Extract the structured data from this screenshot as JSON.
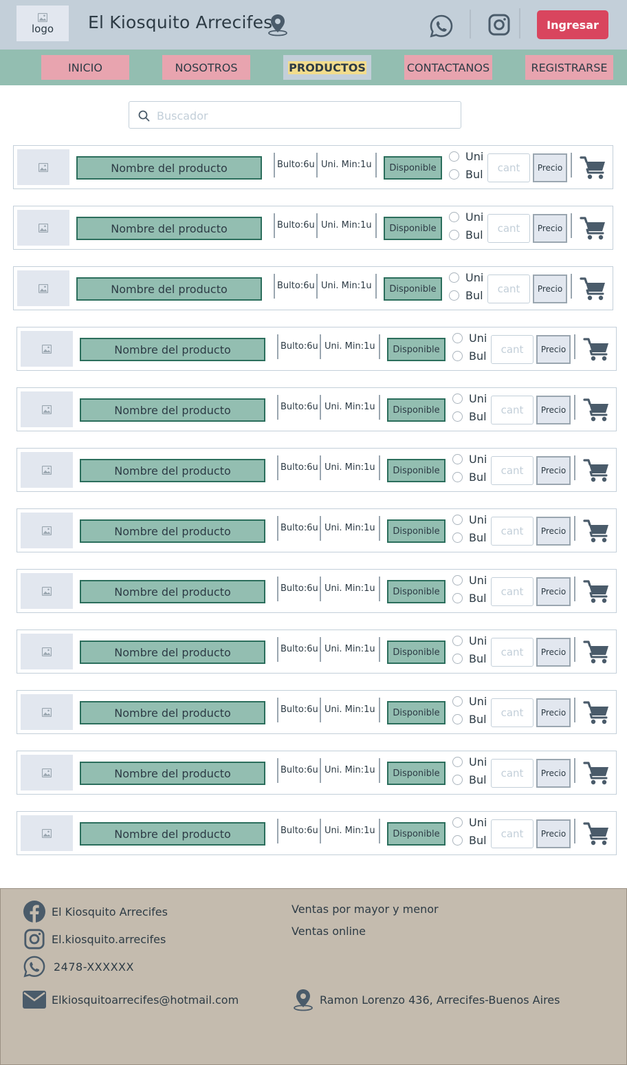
{
  "header": {
    "logo_text": "logo",
    "brand": "El Kiosquito Arrecifes",
    "login_label": "Ingresar"
  },
  "nav": {
    "items": [
      "INICIO",
      "NOSOTROS",
      "PRODUCTOS",
      "CONTACTANOS",
      "REGISTRARSE"
    ],
    "active": "PRODUCTOS"
  },
  "search": {
    "placeholder": "Buscador"
  },
  "products": {
    "name": "Nombre del producto",
    "bulto": "Bulto:6u",
    "unit_min": "Uni. Min:1u",
    "status": "Disponible",
    "option_unit": "Uni",
    "option_bulk": "Bul",
    "qty_placeholder": "cant",
    "price_label": "Precio",
    "count": 12
  },
  "footer": {
    "facebook": "El Kiosquito Arrecifes",
    "instagram": "El.kiosquito.arrecifes",
    "phone": "2478-XXXXXX",
    "email": "Elkiosquitoarrecifes@hotmail.com",
    "line1": "Ventas por mayor y menor",
    "line2": "Ventas online",
    "address": "Ramon Lorenzo 436, Arrecifes-Buenos Aires"
  },
  "colors": {
    "header_bg": "#c3cfd9",
    "nav_bg": "#93beb1",
    "nav_item": "#e8a4af",
    "login_btn": "#d9455e",
    "product_green": "#93beb1",
    "footer_bg": "#c4bbae",
    "icon_dark": "#4a5b6a"
  }
}
